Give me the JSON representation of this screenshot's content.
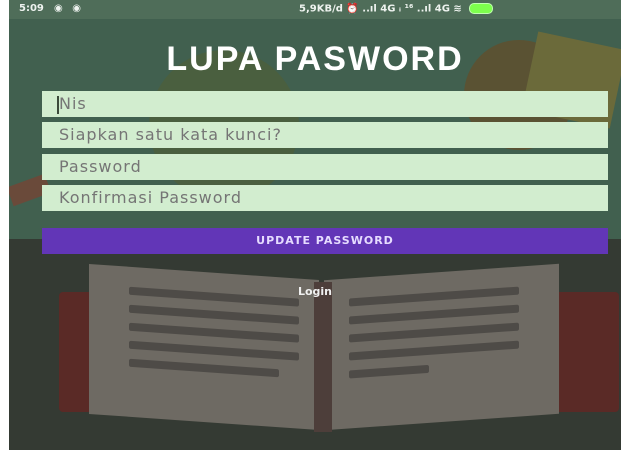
{
  "status_bar": {
    "time": "5:09",
    "indicators": "◉ ◉",
    "right_text": "5,9KB/d ⏰ ..ıl 4G ᵢ ¹⁶ ..ıl 4G ≋"
  },
  "title": "LUPA PASWORD",
  "fields": {
    "nis_placeholder": "Nis",
    "keyword_placeholder": "Siapkan satu kata kunci?",
    "password_placeholder": "Password",
    "confirm_placeholder": "Konfirmasi Password"
  },
  "update_button_label": "UPDATE PASSWORD",
  "login_link_label": "Login",
  "colors": {
    "button": "#6236b7",
    "field_bg": "#d2edcf"
  }
}
